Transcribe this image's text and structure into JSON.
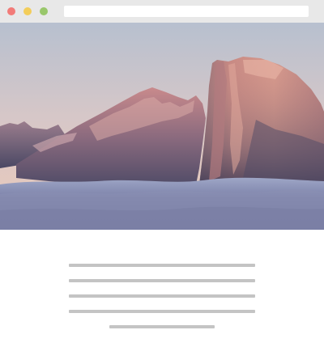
{
  "window": {
    "controls": {
      "close_color": "#f27b78",
      "minimize_color": "#f3cd5a",
      "maximize_color": "#99c76b"
    },
    "address_bar": {
      "value": ""
    }
  },
  "hero_image": {
    "subject": "granite-dome-mountain-above-cloud-sea-at-dusk"
  },
  "content": {
    "placeholder_text_lines": 5
  },
  "colors": {
    "titlebar": "#e8e8e8",
    "text_placeholder": "#c4c4c4",
    "page_background": "#ffffff"
  }
}
